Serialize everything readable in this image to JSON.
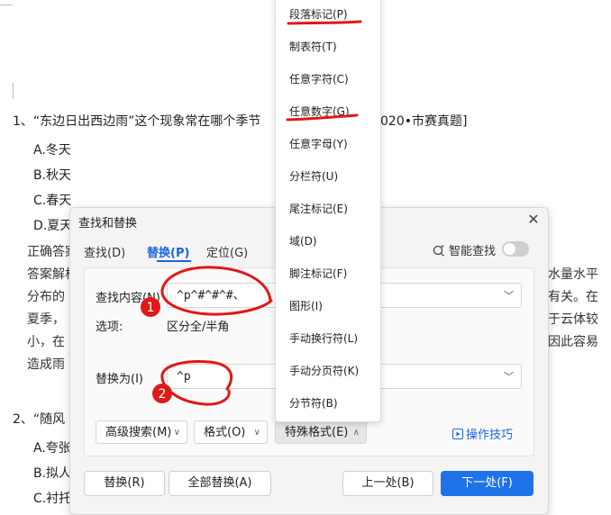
{
  "document": {
    "q1": "1、“东边日出西边雨”这个现象常在哪个季节",
    "q1_tail": "020•市赛真题]",
    "options": [
      "A.冬天",
      "B.秋天",
      "C.春天",
      "D.夏天"
    ],
    "answer_label": "正确答案",
    "analysis_label": "答案解析",
    "analysis_left": [
      "分布的",
      "夏季，",
      "小，在",
      "造成雨"
    ],
    "analysis_right": [
      "水量水平",
      "有关。在",
      "于云体较",
      "因此容易"
    ],
    "q2": "2、“随风",
    "q2_options": [
      "A.夸张",
      "B.拟人",
      "C.衬托"
    ]
  },
  "dialog": {
    "title": "查找和替换",
    "tabs": [
      {
        "label": "查找(D)"
      },
      {
        "label": "替换(P)"
      },
      {
        "label": "定位(G)"
      }
    ],
    "smart_search": "智能查找",
    "find_label": "查找内容(N)",
    "find_value": "^p^#^#^#、",
    "options_label": "选项:",
    "options_value": "区分全/半角",
    "replace_label": "替换为(I)",
    "replace_value": "^p",
    "advanced": "高级搜索(M)",
    "format": "格式(O)",
    "special": "特殊格式(E)",
    "tips": "操作技巧",
    "btn_replace": "替换(R)",
    "btn_replace_all": "全部替换(A)",
    "btn_prev": "上一处(B)",
    "btn_next": "下一处(F)"
  },
  "menu": {
    "items": [
      "段落标记(P)",
      "制表符(T)",
      "任意字符(C)",
      "任意数字(G)",
      "任意字母(Y)",
      "分栏符(U)",
      "尾注标记(E)",
      "域(D)",
      "脚注标记(F)",
      "图形(I)",
      "手动换行符(L)",
      "手动分页符(K)",
      "分节符(B)"
    ]
  },
  "annotations": {
    "marker1": "1",
    "marker2": "2"
  },
  "colors": {
    "accent": "#1f73e8",
    "annotation": "#e01818"
  }
}
